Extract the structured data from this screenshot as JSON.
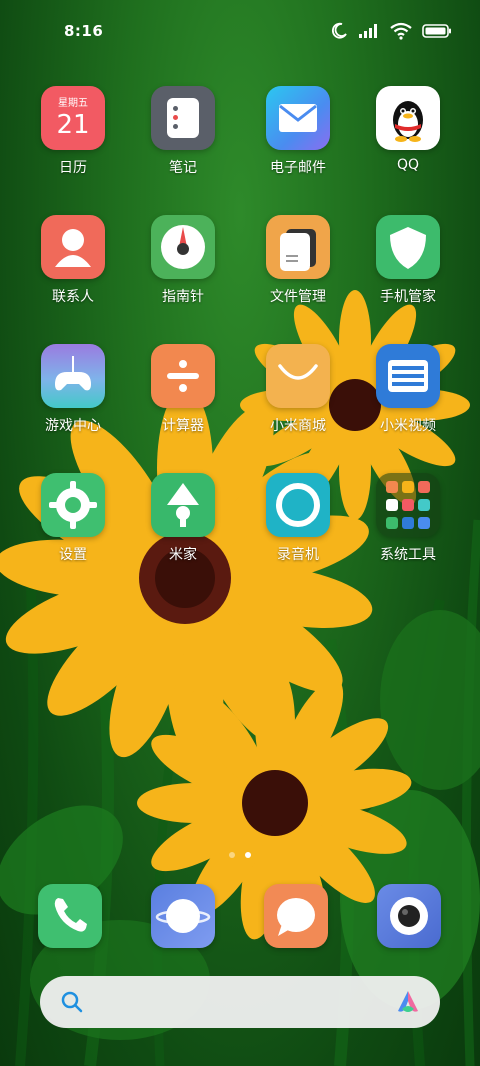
{
  "status": {
    "time": "8:16"
  },
  "calendar": {
    "weekday": "星期五",
    "day": "21"
  },
  "apps": [
    {
      "label": "日历"
    },
    {
      "label": "笔记"
    },
    {
      "label": "电子邮件"
    },
    {
      "label": "QQ"
    },
    {
      "label": "联系人"
    },
    {
      "label": "指南针"
    },
    {
      "label": "文件管理"
    },
    {
      "label": "手机管家"
    },
    {
      "label": "游戏中心"
    },
    {
      "label": "计算器"
    },
    {
      "label": "小米商城"
    },
    {
      "label": "小米视频"
    },
    {
      "label": "设置"
    },
    {
      "label": "米家"
    },
    {
      "label": "录音机"
    },
    {
      "label": "系统工具"
    }
  ],
  "dock": [
    {
      "icon": "phone-icon"
    },
    {
      "icon": "browser-icon"
    },
    {
      "icon": "messages-icon"
    },
    {
      "icon": "camera-icon"
    }
  ],
  "pager": {
    "pages": 2,
    "current": 2
  },
  "colors": {
    "calendar": "#f25a63",
    "notes": "#5a5f69",
    "email": "#3aa7ef",
    "qq": "#ffffff",
    "contacts": "#f06a5a",
    "compass": "#4cb25a",
    "files": "#f0a54a",
    "security": "#3dbb6c",
    "game": "#9a7be0",
    "calculator": "#f2884f",
    "mall": "#f3b24f",
    "video": "#2f7bd8",
    "settings": "#3fbf70",
    "mijia": "#38b86b",
    "recorder": "#1fb3c6",
    "phone": "#3fbf70",
    "browser": "#4a7fe0",
    "message": "#f28a55",
    "camera": "#5477d6"
  }
}
